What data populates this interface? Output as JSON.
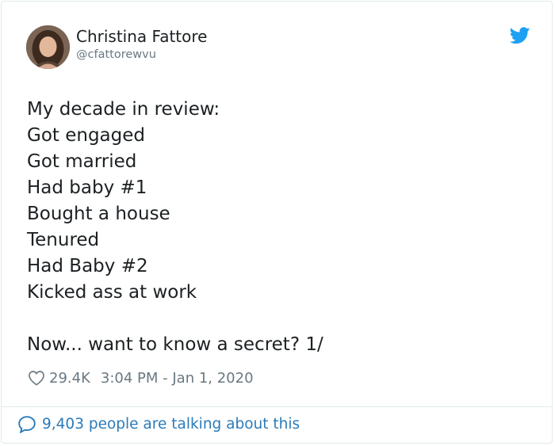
{
  "tweet": {
    "author_name": "Christina Fattore",
    "author_handle": "@cfattorewvu",
    "lines": [
      "My decade in review:",
      "Got engaged",
      "Got married",
      "Had baby #1",
      "Bought a house",
      "Tenured",
      "Had Baby #2",
      "Kicked ass at work",
      "",
      "Now... want to know a secret? 1/"
    ],
    "likes": "29.4K",
    "timestamp": "3:04 PM - Jan 1, 2020",
    "talking": "9,403 people are talking about this"
  },
  "colors": {
    "brand": "#1da1f2",
    "link": "#2b7bb9",
    "muted": "#697882",
    "border": "#e1e8ed"
  },
  "icons": {
    "brand": "twitter-bird-icon",
    "like": "heart-icon",
    "reply": "speech-bubble-icon"
  }
}
